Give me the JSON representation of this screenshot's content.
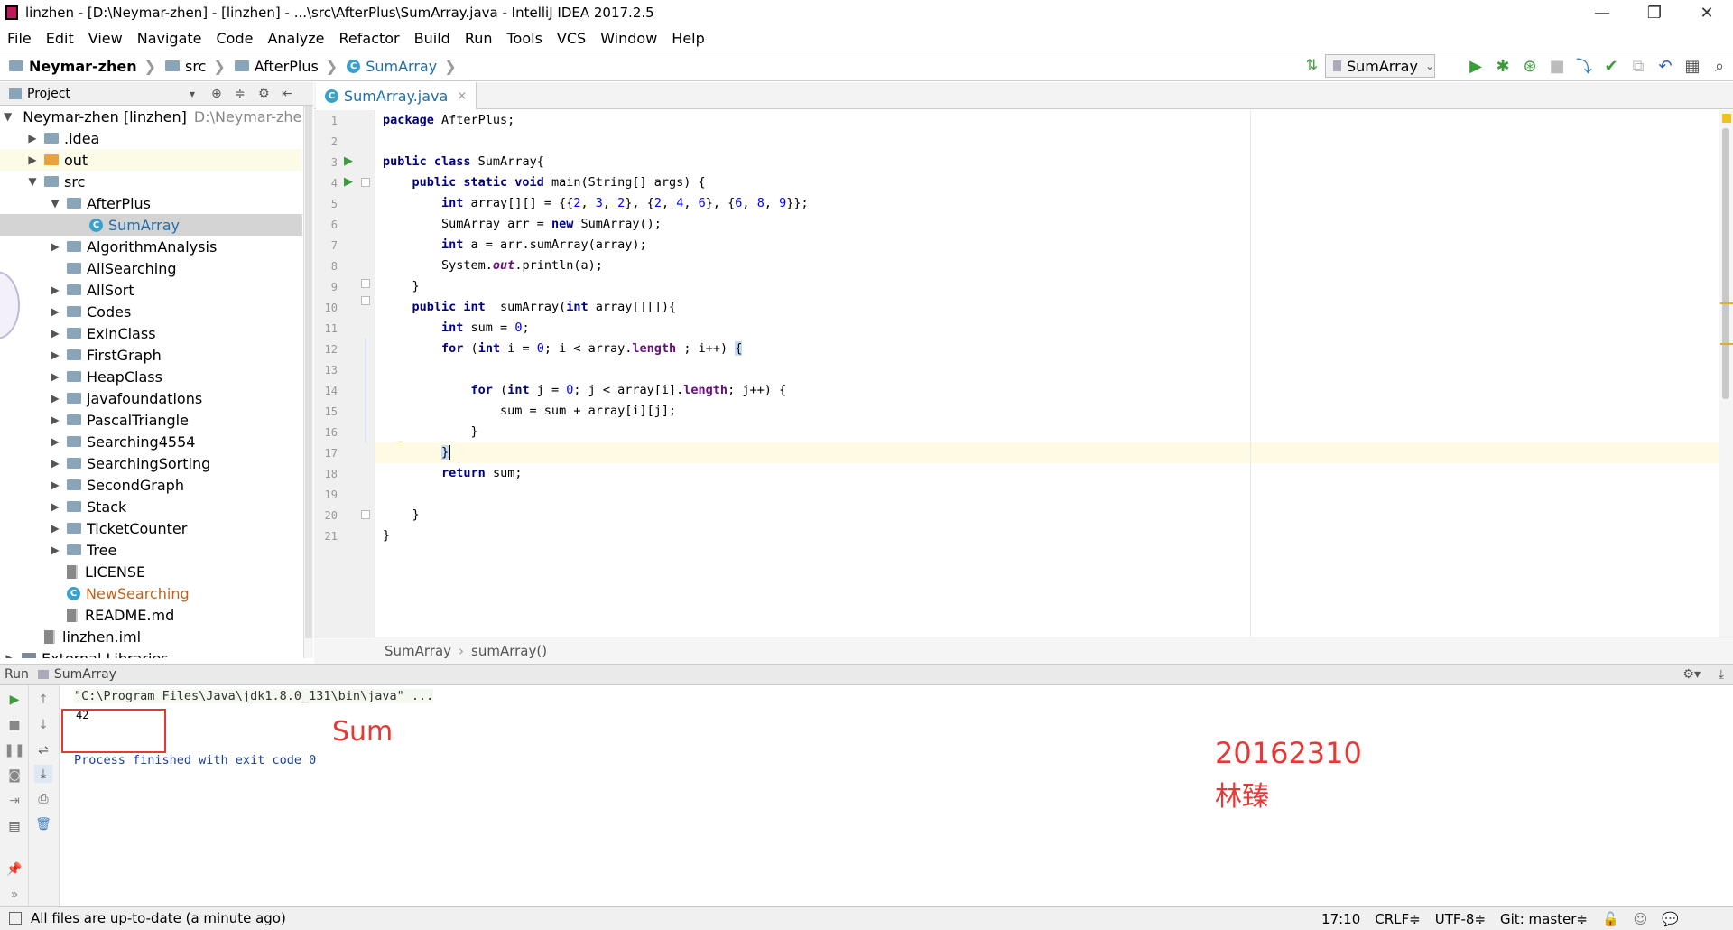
{
  "window": {
    "title": "linzhen - [D:\\Neymar-zhen] - [linzhen] - ...\\src\\AfterPlus\\SumArray.java - IntelliJ IDEA 2017.2.5",
    "minimize": "—",
    "maximize": "❐",
    "close": "✕"
  },
  "menu": [
    "File",
    "Edit",
    "View",
    "Navigate",
    "Code",
    "Analyze",
    "Refactor",
    "Build",
    "Run",
    "Tools",
    "VCS",
    "Window",
    "Help"
  ],
  "navbar": {
    "crumbs": [
      "Neymar-zhen",
      "src",
      "AfterPlus",
      "SumArray"
    ],
    "run_config": "SumArray"
  },
  "project": {
    "header": "Project",
    "root_name": "Neymar-zhen [linzhen]",
    "root_path": "D:\\Neymar-zhen",
    "items": [
      {
        "label": ".idea",
        "type": "folder",
        "indent": 1,
        "arrow": "▶"
      },
      {
        "label": "out",
        "type": "folder-orange",
        "indent": 1,
        "arrow": "▶"
      },
      {
        "label": "src",
        "type": "folder",
        "indent": 1,
        "arrow": "▼"
      },
      {
        "label": "AfterPlus",
        "type": "package",
        "indent": 2,
        "arrow": "▼"
      },
      {
        "label": "SumArray",
        "type": "class",
        "indent": 3,
        "arrow": ""
      },
      {
        "label": "AlgorithmAnalysis",
        "type": "package",
        "indent": 2,
        "arrow": "▶"
      },
      {
        "label": "AllSearching",
        "type": "package",
        "indent": 2,
        "arrow": ""
      },
      {
        "label": "AllSort",
        "type": "package",
        "indent": 2,
        "arrow": "▶"
      },
      {
        "label": "Codes",
        "type": "package",
        "indent": 2,
        "arrow": "▶"
      },
      {
        "label": "ExInClass",
        "type": "package",
        "indent": 2,
        "arrow": "▶"
      },
      {
        "label": "FirstGraph",
        "type": "package",
        "indent": 2,
        "arrow": "▶"
      },
      {
        "label": "HeapClass",
        "type": "package",
        "indent": 2,
        "arrow": "▶"
      },
      {
        "label": "javafoundations",
        "type": "package",
        "indent": 2,
        "arrow": "▶"
      },
      {
        "label": "PascalTriangle",
        "type": "package",
        "indent": 2,
        "arrow": "▶"
      },
      {
        "label": "Searching4554",
        "type": "package",
        "indent": 2,
        "arrow": "▶"
      },
      {
        "label": "SearchingSorting",
        "type": "package",
        "indent": 2,
        "arrow": "▶"
      },
      {
        "label": "SecondGraph",
        "type": "package",
        "indent": 2,
        "arrow": "▶"
      },
      {
        "label": "Stack",
        "type": "package",
        "indent": 2,
        "arrow": "▶"
      },
      {
        "label": "TicketCounter",
        "type": "package",
        "indent": 2,
        "arrow": "▶"
      },
      {
        "label": "Tree",
        "type": "package",
        "indent": 2,
        "arrow": "▶"
      },
      {
        "label": "LICENSE",
        "type": "file",
        "indent": 2,
        "arrow": ""
      },
      {
        "label": "NewSearching",
        "type": "class-orange",
        "indent": 2,
        "arrow": ""
      },
      {
        "label": "README.md",
        "type": "file",
        "indent": 2,
        "arrow": ""
      },
      {
        "label": "linzhen.iml",
        "type": "file",
        "indent": 1,
        "arrow": ""
      },
      {
        "label": "External Libraries",
        "type": "lib",
        "indent": 0,
        "arrow": "▶"
      }
    ]
  },
  "editor": {
    "tab": "SumArray.java",
    "tab_close": "×",
    "breadcrumb": [
      "SumArray",
      "sumArray()"
    ],
    "line_numbers": [
      "1",
      "2",
      "3",
      "4",
      "5",
      "6",
      "7",
      "8",
      "9",
      "10",
      "11",
      "12",
      "13",
      "14",
      "15",
      "16",
      "17",
      "18",
      "19",
      "20",
      "21"
    ],
    "caret_line": 17
  },
  "run": {
    "tab_label": "Run",
    "config": "SumArray",
    "command": "\"C:\\Program Files\\Java\\jdk1.8.0_131\\bin\\java\" ...",
    "output": "42",
    "exit": "Process finished with exit code 0",
    "annotation_sum": "Sum",
    "annotation_id": "20162310",
    "annotation_name": "林臻",
    "annotation_color": "#e53935"
  },
  "status": {
    "message": "All files are up-to-date (a minute ago)",
    "position": "17:10",
    "line_sep": "CRLF≑",
    "encoding": "UTF-8≑",
    "vcs": "Git: master≑"
  },
  "colors": {
    "keyword": "#000080",
    "number": "#0000ff",
    "field": "#660e7a",
    "link": "#1e6fa8",
    "run_green": "#3a9c3a"
  }
}
